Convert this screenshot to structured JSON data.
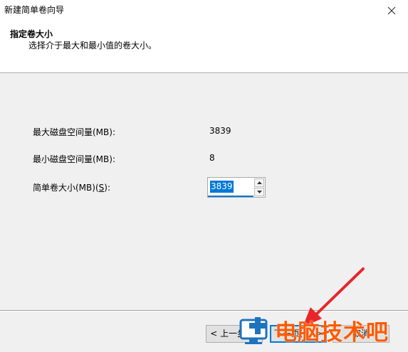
{
  "window": {
    "title": "新建简单卷向导"
  },
  "header": {
    "title": "指定卷大小",
    "subtitle": "选择介于最大和最小值的卷大小。"
  },
  "fields": {
    "max_label": "最大磁盘空间量(MB):",
    "max_value": "3839",
    "min_label": "最小磁盘空间量(MB):",
    "min_value": "8",
    "size_label_prefix": "简单卷大小(MB)(",
    "size_label_key": "S",
    "size_label_suffix": "):",
    "size_value": "3839"
  },
  "buttons": {
    "back": "< 上一步(B)",
    "next": "下一页(N) >",
    "cancel": "取消"
  },
  "watermark": {
    "text": "电脑技术吧"
  },
  "colors": {
    "accent": "#0078d7",
    "watermark": "#ff5a00",
    "arrow": "#e8262a"
  },
  "icons": {
    "close": "close-icon",
    "spin_up": "spin-up-arrow-icon",
    "spin_down": "spin-down-arrow-icon",
    "logo": "monitor-logo-icon"
  }
}
